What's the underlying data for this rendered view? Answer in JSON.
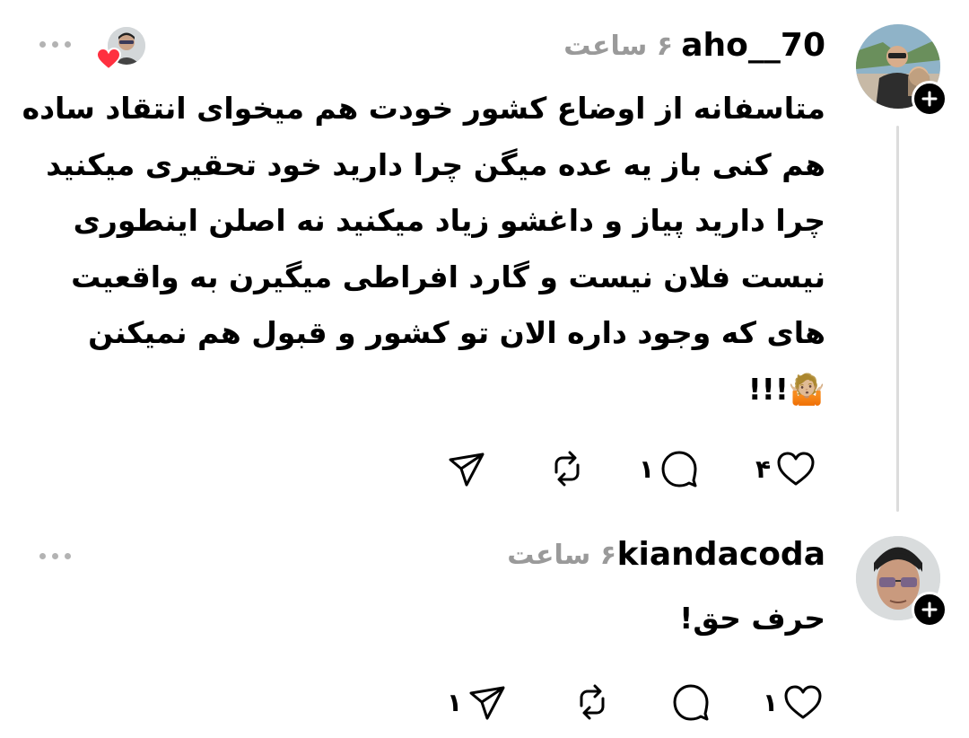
{
  "posts": [
    {
      "username": "aho__70",
      "time": "۶ ساعت",
      "body_lines": [
        "متاسفانه از اوضاع کشور خودت هم میخوای انتقاد ساده",
        "هم کنی باز یه عده میگن چرا دارید خود تحقیری میکنید",
        "چرا دارید پیاز و داغشو زیاد میکنید نه اصلن اینطوری",
        "نیست فلان نیست و گارد افراطی میگیرن به واقعیت",
        "های که وجود داره الان تو کشور و قبول هم نمیکنن",
        "🤷🏼!!!"
      ],
      "likes": "۴",
      "replies": "۱",
      "reposts": "",
      "shares": ""
    },
    {
      "username": "kiandacoda",
      "time": "۶ ساعت",
      "body_lines": [
        "حرف حق!"
      ],
      "likes": "۱",
      "replies": "",
      "reposts": "",
      "shares": "۱"
    }
  ],
  "icons": {
    "follow": "plus-icon",
    "like": "heart-icon",
    "reply": "comment-icon",
    "repost": "repost-icon",
    "share": "send-icon",
    "more": "more-icon",
    "liked_badge": "heart-badge-icon"
  },
  "colors": {
    "liked_red": "#ff3040",
    "muted": "#9a9a9a"
  }
}
